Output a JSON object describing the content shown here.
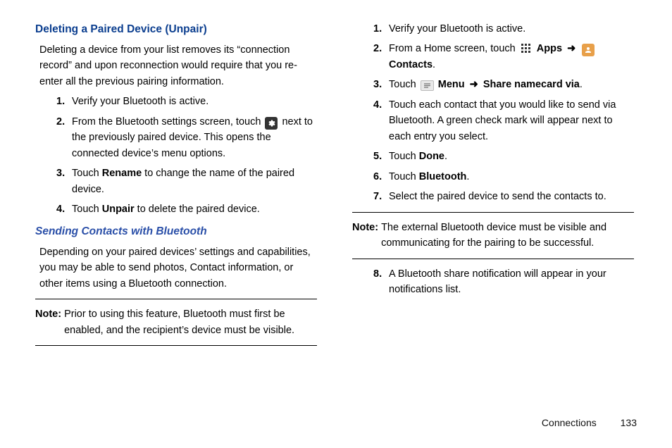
{
  "left": {
    "heading1": "Deleting a Paired Device (Unpair)",
    "para1": "Deleting a device from your list removes its “connection record” and upon reconnection would require that you re-enter all the previous pairing information.",
    "steps1": {
      "s1": "Verify your Bluetooth is active.",
      "s2a": "From the Bluetooth settings screen, touch ",
      "s2b": " next to the previously paired device. This opens the connected device’s menu options.",
      "s3a": "Touch ",
      "s3b": "Rename",
      "s3c": " to change the name of the paired device.",
      "s4a": "Touch ",
      "s4b": "Unpair",
      "s4c": " to delete the paired device."
    },
    "heading2": "Sending Contacts with Bluetooth",
    "para2": "Depending on your paired devices’ settings and capabilities, you may be able to send photos, Contact information, or other items using a Bluetooth connection.",
    "noteLabel": "Note:",
    "note": "Prior to using this feature, Bluetooth must first be enabled, and the recipient’s device must be visible."
  },
  "right": {
    "steps": {
      "s1": "Verify your Bluetooth is active.",
      "s2a": "From a Home screen, touch ",
      "s2apps": "Apps",
      "s2contacts": "Contacts",
      "s3a": "Touch ",
      "s3menu": "Menu",
      "s3share": "Share namecard via",
      "s4": "Touch each contact that you would like to send via Bluetooth. A green check mark will appear next to each entry you select.",
      "s5a": "Touch ",
      "s5b": "Done",
      "s6a": "Touch ",
      "s6b": "Bluetooth",
      "s7": "Select the paired device to send the contacts to."
    },
    "noteLabel": "Note:",
    "note": "The external Bluetooth device must be visible and communicating for the pairing to be successful.",
    "s8": "A Bluetooth share notification will appear in your notifications list."
  },
  "footer": {
    "section": "Connections",
    "page": "133"
  },
  "nums": {
    "n1": "1.",
    "n2": "2.",
    "n3": "3.",
    "n4": "4.",
    "n5": "5.",
    "n6": "6.",
    "n7": "7.",
    "n8": "8."
  },
  "arrow": "➜",
  "period": "."
}
